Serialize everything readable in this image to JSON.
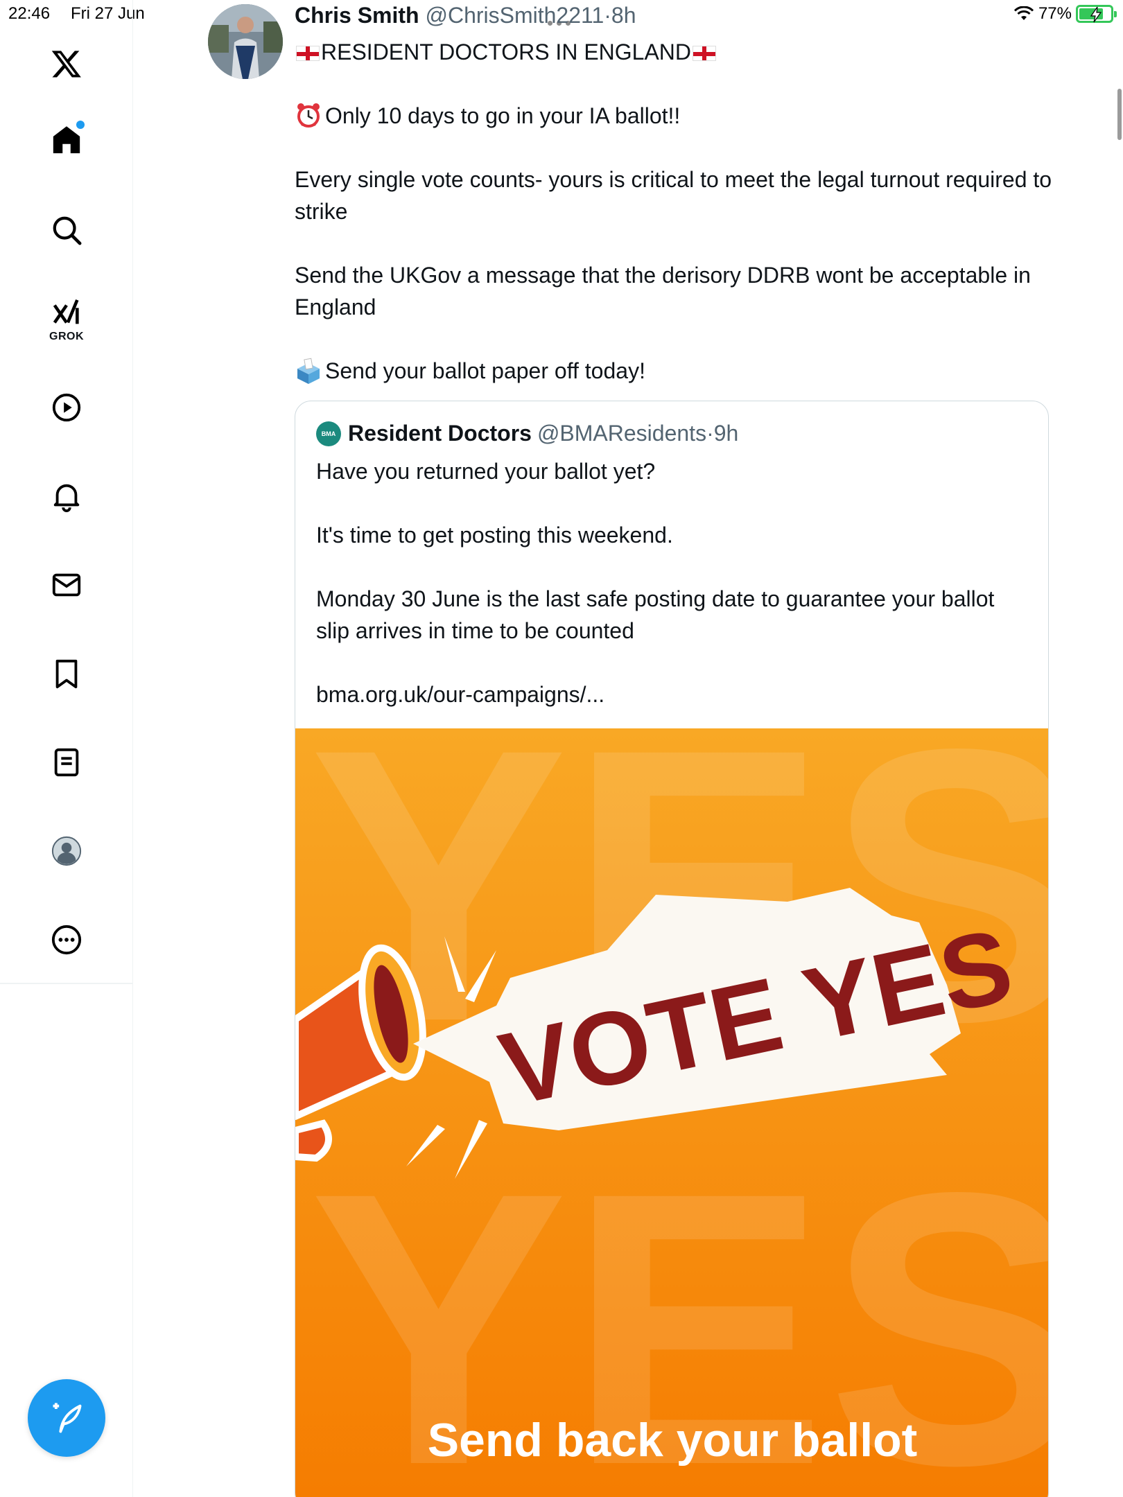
{
  "status_bar": {
    "time": "22:46",
    "date": "Fri 27 Jun",
    "battery": "77%"
  },
  "sidebar": {
    "logo": "x-logo-icon",
    "items": [
      {
        "name": "home",
        "icon": "home-icon"
      },
      {
        "name": "explore",
        "icon": "search-icon"
      },
      {
        "name": "grok",
        "icon": "grok-icon",
        "label": "GROK"
      },
      {
        "name": "videos",
        "icon": "play-icon"
      },
      {
        "name": "notifications",
        "icon": "bell-icon"
      },
      {
        "name": "messages",
        "icon": "mail-icon"
      },
      {
        "name": "bookmarks",
        "icon": "bookmark-icon"
      },
      {
        "name": "lists",
        "icon": "list-icon"
      },
      {
        "name": "profile",
        "icon": "profile-icon"
      },
      {
        "name": "more",
        "icon": "more-icon"
      }
    ],
    "compose_icon": "compose-post-icon"
  },
  "tweet": {
    "author_name": "Chris Smith",
    "author_handle": "@ChrisSmith2211",
    "separator": "·",
    "time": "8h",
    "headline": "RESIDENT DOCTORS IN ENGLAND",
    "line1": "Only 10 days to go in your IA ballot!!",
    "line2": "Every single vote counts- yours is critical to meet the legal turnout required to strike",
    "line3": "Send the UKGov a message that the derisory DDRB wont be acceptable in England",
    "line4": "Send your ballot paper off today!"
  },
  "quoted_tweet": {
    "author_name": "Resident Doctors",
    "author_handle": "@BMAResidents",
    "separator": "·",
    "time": "9h",
    "logo_text": "BMA",
    "para1": "Have you returned your ballot yet?",
    "para2": "It's time to get posting this weekend.",
    "para3": "Monday 30 June is the last safe posting date to guarantee your ballot slip arrives in time to be counted",
    "link": "bma.org.uk/our-campaigns/...",
    "image": {
      "background_word": "YES",
      "headline": "VOTE YES",
      "caption": "Send back your ballot",
      "colors": {
        "orange": "#f7931e",
        "dark_red": "#8b1a1a",
        "white": "#ffffff"
      }
    }
  }
}
